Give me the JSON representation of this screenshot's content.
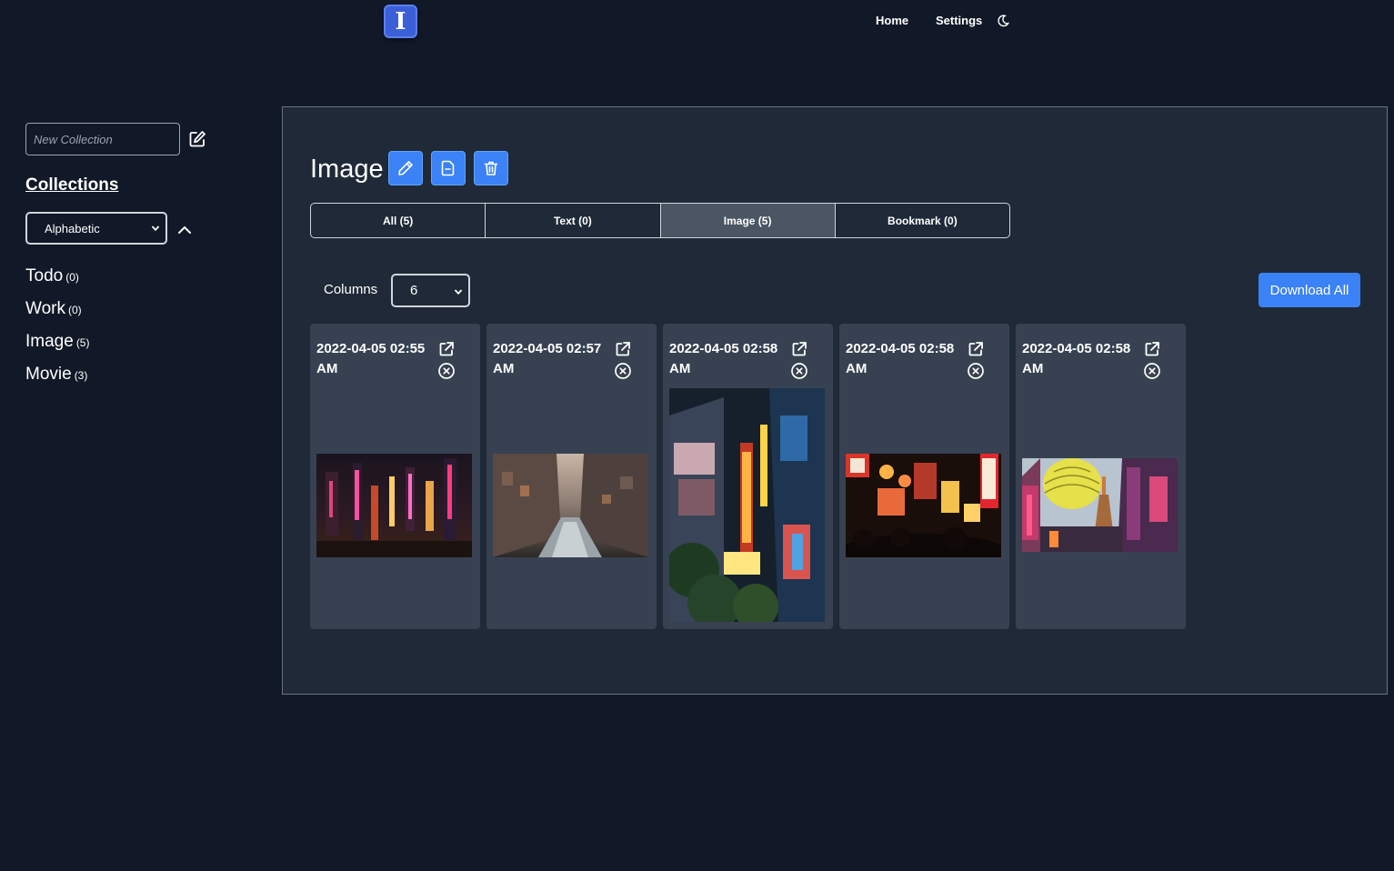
{
  "nav": {
    "logo_glyph": "I",
    "home_label": "Home",
    "settings_label": "Settings",
    "theme_icon": "moon-icon"
  },
  "sidebar": {
    "new_collection_placeholder": "New Collection",
    "collections_title": "Collections",
    "sort_value": "Alphabetic",
    "collections": [
      {
        "name": "Todo",
        "count": "(0)"
      },
      {
        "name": "Work",
        "count": "(0)"
      },
      {
        "name": "Image",
        "count": "(5)"
      },
      {
        "name": "Movie",
        "count": "(3)"
      }
    ]
  },
  "main": {
    "title": "Image",
    "tabs": [
      {
        "label": "All (5)",
        "active": false
      },
      {
        "label": "Text (0)",
        "active": false
      },
      {
        "label": "Image (5)",
        "active": true
      },
      {
        "label": "Bookmark (0)",
        "active": false
      }
    ],
    "columns_label": "Columns",
    "columns_value": "6",
    "download_label": "Download All",
    "cards": [
      {
        "date": "2022-04-05 02:55 AM",
        "image": "neon city street at night"
      },
      {
        "date": "2022-04-05 02:57 AM",
        "image": "canal between buildings"
      },
      {
        "date": "2022-04-05 02:58 AM",
        "image": "vertical neon signs street"
      },
      {
        "date": "2022-04-05 02:58 AM",
        "image": "crowded neon alley"
      },
      {
        "date": "2022-04-05 02:58 AM",
        "image": "yellow lantern and tower"
      }
    ]
  },
  "colors": {
    "background": "#111827",
    "panel": "#1f2937",
    "card": "#374151",
    "accent": "#3b82f6",
    "active_tab": "#4b5563"
  }
}
